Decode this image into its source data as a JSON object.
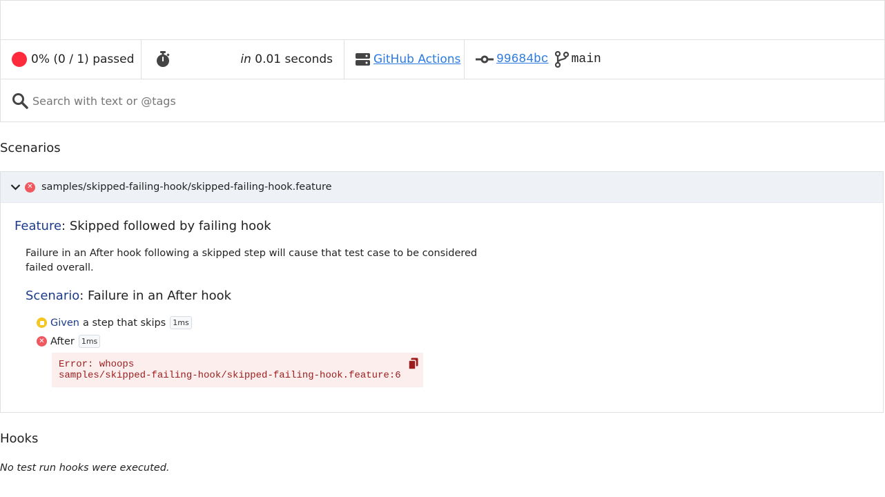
{
  "summary": {
    "status_text": "0% (0 / 1) passed",
    "status_color": "#ff2a3b",
    "time_prefix": "in",
    "time_value": " 0.01 seconds",
    "ci_name": "GitHub Actions",
    "commit": "99684bc",
    "branch": "main"
  },
  "search": {
    "placeholder": "Search with text or @tags"
  },
  "scenarios_title": "Scenarios",
  "feature": {
    "path": "samples/skipped-failing-hook/skipped-failing-hook.feature",
    "keyword": "Feature",
    "name": ": Skipped followed by failing hook",
    "description": "Failure in an After hook following a skipped step will cause that test case to be considered failed overall.",
    "scenario": {
      "keyword": "Scenario",
      "name": ": Failure in an After hook",
      "steps": [
        {
          "keyword": "Given",
          "text": "a step that skips",
          "duration": "1ms",
          "status": "skipped"
        },
        {
          "keyword": "After",
          "text": "",
          "duration": "1ms",
          "status": "failed"
        }
      ],
      "error_line1": "Error: whoops",
      "error_line2": "samples/skipped-failing-hook/skipped-failing-hook.feature:6"
    }
  },
  "hooks_title": "Hooks",
  "hooks_note": "No test run hooks were executed."
}
